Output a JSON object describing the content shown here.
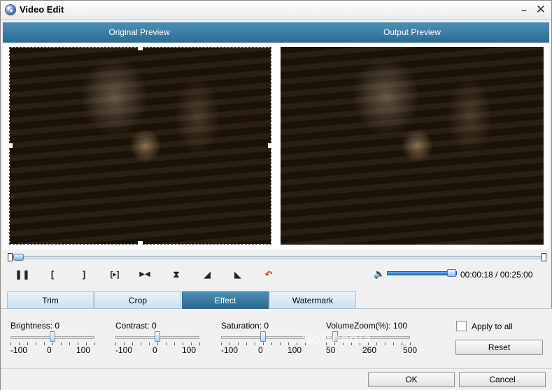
{
  "window": {
    "title": "Video Edit",
    "minimize_label": "–",
    "close_label": "✕"
  },
  "preview": {
    "original_label": "Original Preview",
    "output_label": "Output Preview"
  },
  "playback": {
    "pause_glyph": "❚❚",
    "mark_in_glyph": "[",
    "mark_out_glyph": "]",
    "clip_glyph": "[▸]",
    "next_frame_glyph": "▶◀",
    "flip_vertical_glyph": "⧗",
    "rotate_left_glyph": "◢",
    "rotate_right_glyph": "◣",
    "undo_glyph": "↶",
    "volume_glyph": "🔈",
    "time": "00:00:18 / 00:25:00"
  },
  "tabs": [
    {
      "label": "Trim"
    },
    {
      "label": "Crop"
    },
    {
      "label": "Effect",
      "active": true
    },
    {
      "label": "Watermark"
    }
  ],
  "effect": {
    "brightness": {
      "label": "Brightness: 0",
      "min": "-100",
      "mid": "0",
      "max": "100",
      "value_fraction": 0.5
    },
    "contrast": {
      "label": "Contrast: 0",
      "min": "-100",
      "mid": "0",
      "max": "100",
      "value_fraction": 0.5
    },
    "saturation": {
      "label": "Saturation: 0",
      "min": "-100",
      "mid": "0",
      "max": "100",
      "value_fraction": 0.5
    },
    "volume_zoom": {
      "label": "VolumeZoom(%): 100",
      "min": "50",
      "mid": "260",
      "max": "500",
      "value_fraction": 0.11
    },
    "apply_to_all": "Apply to all",
    "reset": "Reset"
  },
  "watermark_text": "Softpedia",
  "footer": {
    "ok": "OK",
    "cancel": "Cancel"
  },
  "colors": {
    "header_blue": "#2c6c93",
    "active_tab": "#3b7ba3"
  }
}
